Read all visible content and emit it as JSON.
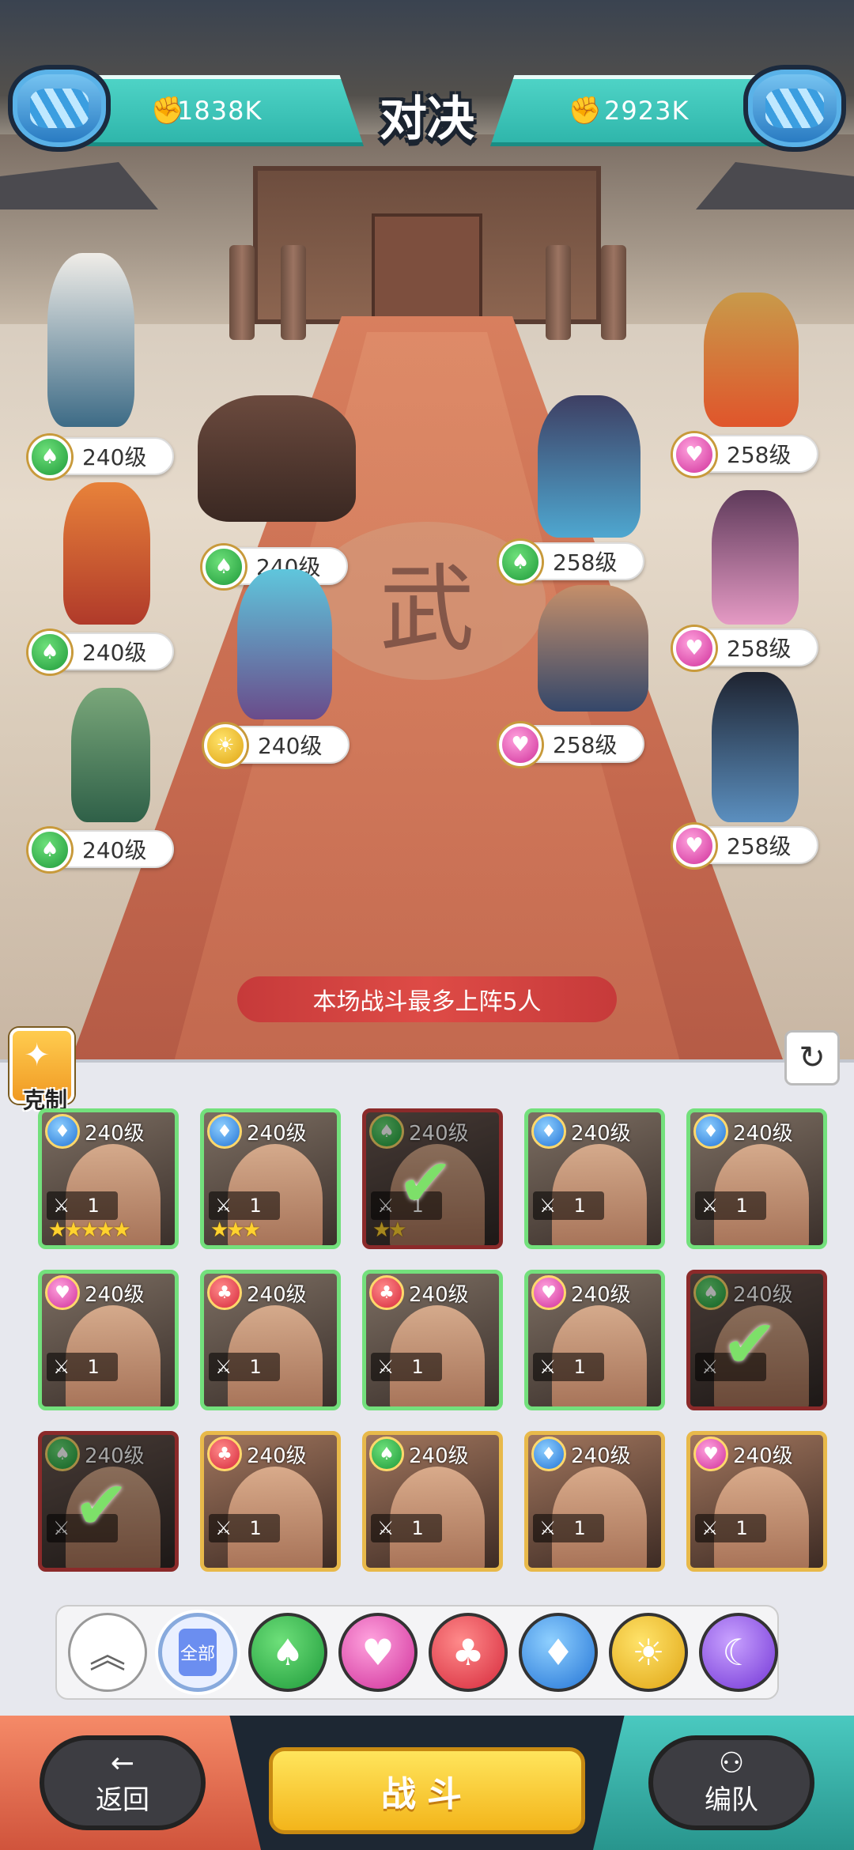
{
  "header": {
    "left_power": "1838K",
    "right_power": "2923K",
    "title": "对决"
  },
  "arena": {
    "notice": "本场战斗最多上阵5人",
    "floor_mark": "武",
    "left_heroes": [
      {
        "level": "240级",
        "camp": "green"
      },
      {
        "level": "240级",
        "camp": "green"
      },
      {
        "level": "240级",
        "camp": "green"
      },
      {
        "level": "240级",
        "camp": "green"
      },
      {
        "level": "240级",
        "camp": "yellow"
      },
      {
        "level": "240级",
        "camp": "green"
      }
    ],
    "right_heroes": [
      {
        "level": "258级",
        "camp": "pink"
      },
      {
        "level": "258级",
        "camp": "green"
      },
      {
        "level": "258级",
        "camp": "pink"
      },
      {
        "level": "258级",
        "camp": "pink"
      },
      {
        "level": "258级",
        "camp": "pink"
      }
    ]
  },
  "panel": {
    "counter_label": "克制",
    "cards": [
      {
        "level": "240级",
        "power": "1",
        "camp": "blue",
        "stars": "★★★★★",
        "selected": false
      },
      {
        "level": "240级",
        "power": "1",
        "camp": "blue",
        "stars": "★★★",
        "selected": false
      },
      {
        "level": "240级",
        "power": "1",
        "camp": "green",
        "stars": "★★",
        "selected": true
      },
      {
        "level": "240级",
        "power": "1",
        "camp": "blue",
        "stars": "",
        "selected": false
      },
      {
        "level": "240级",
        "power": "1",
        "camp": "blue",
        "stars": "",
        "selected": false
      },
      {
        "level": "240级",
        "power": "1",
        "camp": "pink",
        "stars": "",
        "selected": false
      },
      {
        "level": "240级",
        "power": "1",
        "camp": "red",
        "stars": "",
        "selected": false
      },
      {
        "level": "240级",
        "power": "1",
        "camp": "red",
        "stars": "",
        "selected": false
      },
      {
        "level": "240级",
        "power": "1",
        "camp": "pink",
        "stars": "",
        "selected": false
      },
      {
        "level": "240级",
        "power": "",
        "camp": "green",
        "stars": "",
        "selected": true
      },
      {
        "level": "240级",
        "power": "",
        "camp": "green",
        "stars": "",
        "selected": true
      },
      {
        "level": "240级",
        "power": "1",
        "camp": "red",
        "stars": "",
        "selected": false
      },
      {
        "level": "240级",
        "power": "1",
        "camp": "green",
        "stars": "",
        "selected": false
      },
      {
        "level": "240级",
        "power": "1",
        "camp": "blue",
        "stars": "",
        "selected": false
      },
      {
        "level": "240级",
        "power": "1",
        "camp": "pink",
        "stars": "",
        "selected": false
      }
    ],
    "filters": [
      {
        "name": "collapse",
        "icon": "chevron-up-icon"
      },
      {
        "name": "all",
        "label": "全部"
      },
      {
        "name": "green",
        "icon": "spade-icon",
        "color": "#2aa848"
      },
      {
        "name": "pink",
        "icon": "heart-icon",
        "color": "#d83aa2"
      },
      {
        "name": "red",
        "icon": "club-icon",
        "color": "#d9303f"
      },
      {
        "name": "blue",
        "icon": "diamond-icon",
        "color": "#2a7ee0"
      },
      {
        "name": "yellow",
        "icon": "sun-icon",
        "color": "#e8b21c"
      },
      {
        "name": "purple",
        "icon": "moon-icon",
        "color": "#7c3ddb"
      }
    ]
  },
  "footer": {
    "back_label": "返回",
    "fight_label": "战斗",
    "team_label": "编队"
  }
}
